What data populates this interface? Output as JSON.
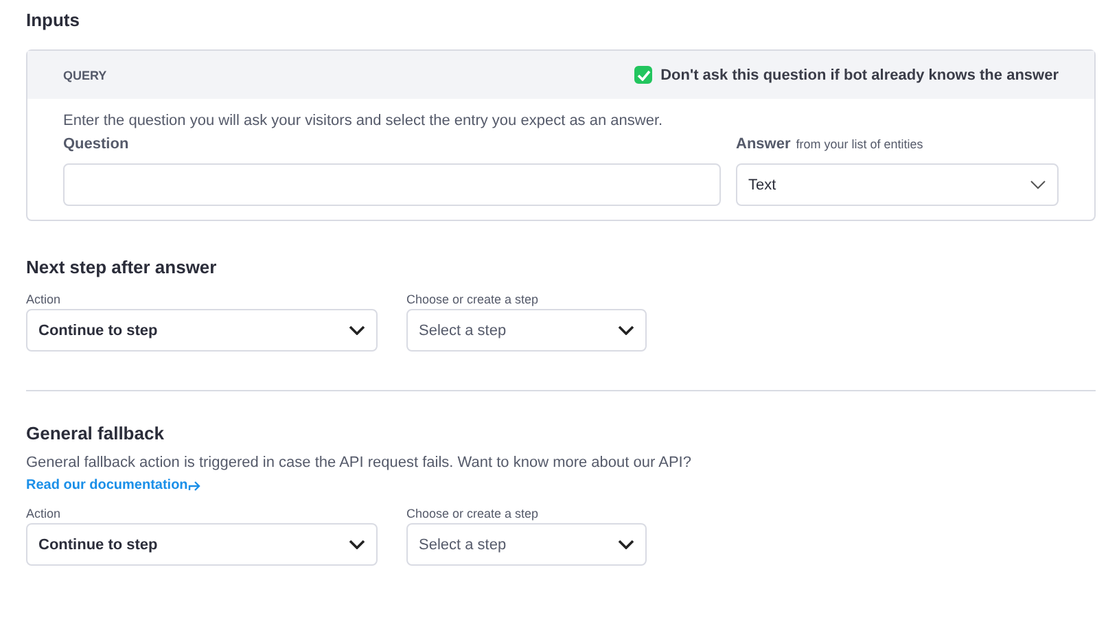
{
  "inputs": {
    "title": "Inputs",
    "card": {
      "header": "QUERY",
      "skip_option": {
        "label": "Don't ask this question if bot already knows the answer",
        "checked": true
      },
      "description": "Enter the question you will ask your visitors and select the entry you expect as an answer.",
      "question": {
        "label": "Question"
      },
      "answer": {
        "label": "Answer",
        "hint": "from your list of entities",
        "value": "Text"
      }
    }
  },
  "sections": [
    {
      "title": "Next step after answer",
      "action": {
        "label": "Action",
        "value": "Continue to step"
      },
      "step": {
        "label": "Choose or create a step",
        "placeholder": "Select a step"
      }
    },
    {
      "title": "General fallback",
      "description": "General fallback action is triggered in case the API request fails. Want to know more about our API?",
      "link": "Read our documentation",
      "action": {
        "label": "Action",
        "value": "Continue to step"
      },
      "step": {
        "label": "Choose or create a step",
        "placeholder": "Select a step"
      }
    }
  ]
}
